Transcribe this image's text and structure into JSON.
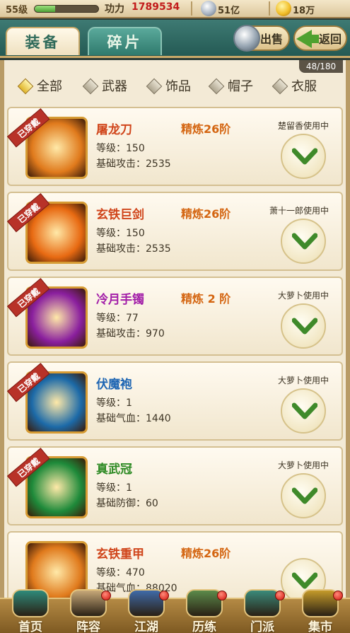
{
  "status_bar": {
    "level": "55级",
    "exp_fraction": 0.32,
    "power_label": "功力",
    "power_value": "1789534",
    "silver": "51亿",
    "gold": "18万"
  },
  "header": {
    "tabs": [
      {
        "label": "装备",
        "active": true
      },
      {
        "label": "碎片",
        "active": false
      }
    ],
    "sell_label": "出售",
    "back_label": "返回"
  },
  "inventory": {
    "count": "48/180",
    "filters": [
      {
        "label": "全部",
        "active": true
      },
      {
        "label": "武器",
        "active": false
      },
      {
        "label": "饰品",
        "active": false
      },
      {
        "label": "帽子",
        "active": false
      },
      {
        "label": "衣服",
        "active": false
      }
    ],
    "items": [
      {
        "worn_tag": "已穿戴",
        "name": "屠龙刀",
        "name_color": "#d0451b",
        "refine": "精炼26阶",
        "level": "等级：150",
        "stat": "基础攻击：2535",
        "user": "楚留香使用中",
        "icon": "golden-saber-icon",
        "icon_bg": "#e07a1c"
      },
      {
        "worn_tag": "已穿戴",
        "name": "玄铁巨剑",
        "name_color": "#d0451b",
        "refine": "精炼26阶",
        "level": "等级：150",
        "stat": "基础攻击：2535",
        "user": "萧十一郎使用中",
        "icon": "great-sword-icon",
        "icon_bg": "#e86a12"
      },
      {
        "worn_tag": "已穿戴",
        "name": "冷月手镯",
        "name_color": "#a21ea8",
        "refine": "精炼 2 阶",
        "level": "等级：77",
        "stat": "基础攻击：970",
        "user": "大萝卜使用中",
        "icon": "bracelet-icon",
        "icon_bg": "#8a1f9e"
      },
      {
        "worn_tag": "已穿戴",
        "name": "伏魔袍",
        "name_color": "#1f66b3",
        "refine": "",
        "level": "等级：1",
        "stat": "基础气血：1440",
        "user": "大萝卜使用中",
        "icon": "robe-icon",
        "icon_bg": "#1c6aa8"
      },
      {
        "worn_tag": "已穿戴",
        "name": "真武冠",
        "name_color": "#2e8a24",
        "refine": "",
        "level": "等级：1",
        "stat": "基础防御：60",
        "user": "大萝卜使用中",
        "icon": "crown-icon",
        "icon_bg": "#1e8a3a"
      },
      {
        "worn_tag": "",
        "name": "玄铁重甲",
        "name_color": "#d0451b",
        "refine": "精炼26阶",
        "level": "等级：470",
        "stat": "基础气血：88020",
        "user": "",
        "icon": "armor-icon",
        "icon_bg": "#e07a1c"
      }
    ]
  },
  "bottom_nav": [
    {
      "label": "首页",
      "icon": "home-icon",
      "color": "#2f8a7a",
      "badge": false
    },
    {
      "label": "阵容",
      "icon": "scroll-icon",
      "color": "#c7a878",
      "badge": true
    },
    {
      "label": "江湖",
      "icon": "book-icon",
      "color": "#3f6aa8",
      "badge": true
    },
    {
      "label": "历练",
      "icon": "gourd-icon",
      "color": "#5c8a4a",
      "badge": true
    },
    {
      "label": "门派",
      "icon": "banner-icon",
      "color": "#3a8a7a",
      "badge": true
    },
    {
      "label": "集市",
      "icon": "chest-icon",
      "color": "#c49a2a",
      "badge": true
    }
  ]
}
